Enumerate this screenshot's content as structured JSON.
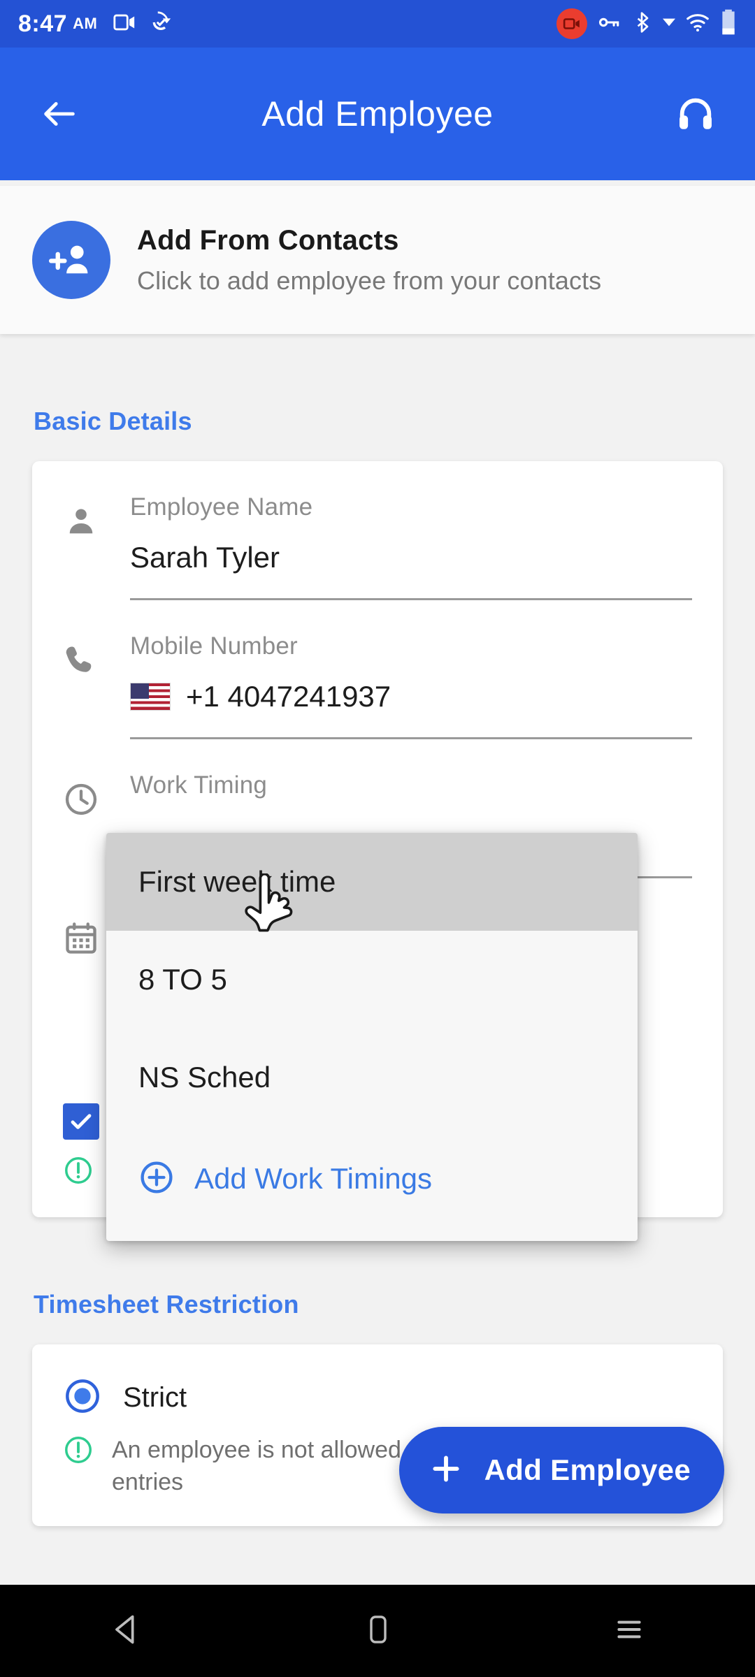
{
  "status_bar": {
    "time": "8:47",
    "ampm": "AM",
    "icons": [
      "screen-cast-icon",
      "sync-check-icon",
      "screen-record-icon",
      "vpn-key-icon",
      "bluetooth-icon",
      "dropdown-arrow-icon",
      "wifi-icon",
      "battery-icon"
    ]
  },
  "app_bar": {
    "title": "Add Employee",
    "back_icon": "back-arrow-icon",
    "support_icon": "headset-icon"
  },
  "contacts_banner": {
    "icon": "person-add-icon",
    "title": "Add From Contacts",
    "subtitle": "Click to add employee from your contacts"
  },
  "basic_details": {
    "section_label": "Basic Details",
    "fields": [
      {
        "icon": "person-icon",
        "label": "Employee Name",
        "value": "Sarah Tyler"
      },
      {
        "icon": "phone-icon",
        "label": "Mobile Number",
        "value": "+1 4047241937",
        "flag": "us-flag-icon"
      },
      {
        "icon": "clock-icon",
        "label": "Work Timing",
        "value": ""
      },
      {
        "icon": "calendar-icon",
        "label": "",
        "value": ""
      }
    ],
    "checkbox": {
      "checked": true,
      "label": ""
    },
    "hint": {
      "icon": "info-icon",
      "text": ""
    }
  },
  "work_timing_dropdown": {
    "options": [
      "First week time",
      "8 TO 5",
      "NS Sched"
    ],
    "highlighted_index": 0,
    "add_option": {
      "icon": "circle-plus-icon",
      "label": "Add Work Timings"
    }
  },
  "timesheet_restriction": {
    "section_label": "Timesheet Restriction",
    "option_label": "Strict",
    "option_selected": true,
    "hint_icon": "info-icon",
    "hint_text": "An employee is not allowed to add/edit/delete time entries"
  },
  "fab": {
    "icon": "plus-icon",
    "label": "Add Employee"
  },
  "nav_bar": {
    "back": "nav-back-icon",
    "home": "nav-home-icon",
    "recents": "nav-recents-icon"
  },
  "colors": {
    "status_bar": "#2452d4",
    "app_bar": "#2961e8",
    "accent_blue": "#3f7bea",
    "fab_blue": "#2452d9",
    "info_green": "#2ecc8f",
    "page_bg": "#f2f2f2"
  },
  "cursor": {
    "type": "pointing-hand-cursor"
  }
}
